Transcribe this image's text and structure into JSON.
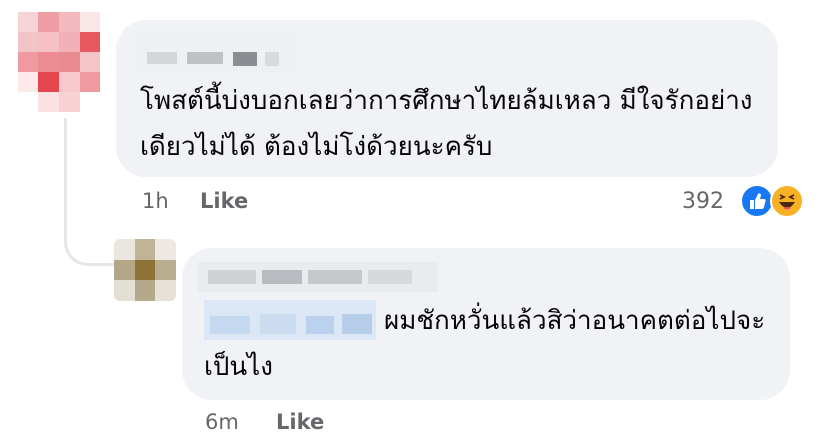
{
  "comments": [
    {
      "text": "โพสต์นี้บ่งบอกเลยว่าการศึกษาไทยล้มเหลว มีใจรักอย่างเดียวไม่ได้ ต้องไม่โง่ด้วยนะครับ",
      "time": "1h",
      "like_label": "Like",
      "reaction_count": "392",
      "reactions": [
        "like-icon",
        "haha-icon"
      ]
    },
    {
      "text": "ผมชักหวั่นแล้วสิว่าอนาคตต่อไปจะเป็นไง",
      "time": "6m",
      "like_label": "Like"
    }
  ],
  "colors": {
    "bubble": "#f0f2f5",
    "meta_text": "#65676b",
    "like_blue": "#1877f2",
    "haha_yellow": "#f7b125"
  }
}
